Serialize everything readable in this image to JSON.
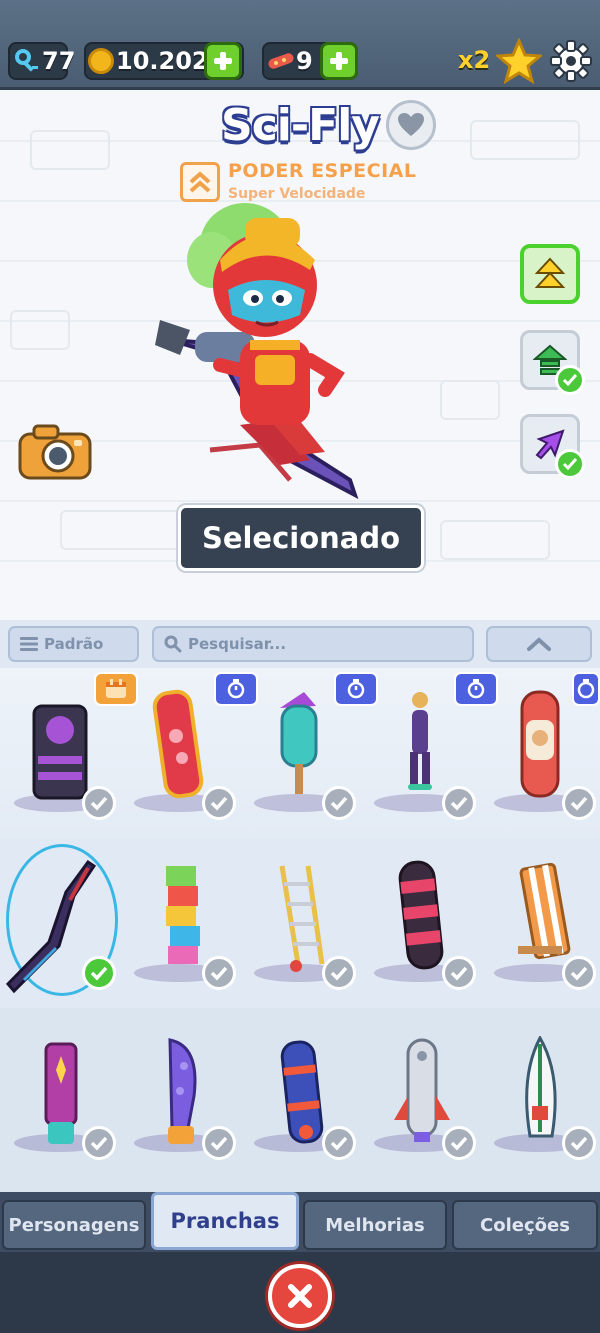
{
  "status_bar": {
    "keys": "77",
    "coins": "10.202",
    "boards": "9",
    "multiplier": "x2"
  },
  "showcase": {
    "board_name": "Sci-Fly",
    "power_title": "PODER ESPECIAL",
    "power_subtitle": "Super Velocidade",
    "select_label": "Selecionado"
  },
  "filter": {
    "sort_label": "Padrão",
    "search_placeholder": "Pesquisar..."
  },
  "colors": {
    "accent_green": "#4cc83b",
    "topbar": "#4a5d72",
    "title_outline": "#2d3e92",
    "tab_active_text": "#2f3f8e",
    "close_red": "#e5463d"
  },
  "tabs": [
    {
      "label": "Personagens",
      "active": false
    },
    {
      "label": "Pranchas",
      "active": true
    },
    {
      "label": "Melhorias",
      "active": false
    },
    {
      "label": "Coleções",
      "active": false
    }
  ],
  "boards": [
    {
      "tag": "calendar-icon",
      "owned": true,
      "selected": false
    },
    {
      "tag": "timer-icon",
      "owned": true,
      "selected": false
    },
    {
      "tag": "timer-icon",
      "owned": true,
      "selected": false
    },
    {
      "tag": "timer-icon",
      "owned": true,
      "selected": false
    },
    {
      "tag": "timer-icon",
      "owned": true,
      "selected": false
    },
    {
      "tag": "",
      "owned": true,
      "selected": true
    },
    {
      "tag": "",
      "owned": true,
      "selected": false
    },
    {
      "tag": "",
      "owned": true,
      "selected": false
    },
    {
      "tag": "",
      "owned": true,
      "selected": false
    },
    {
      "tag": "",
      "owned": true,
      "selected": false
    },
    {
      "tag": "",
      "owned": true,
      "selected": false
    },
    {
      "tag": "",
      "owned": true,
      "selected": false
    },
    {
      "tag": "",
      "owned": true,
      "selected": false
    },
    {
      "tag": "",
      "owned": true,
      "selected": false
    },
    {
      "tag": "",
      "owned": true,
      "selected": false
    }
  ]
}
